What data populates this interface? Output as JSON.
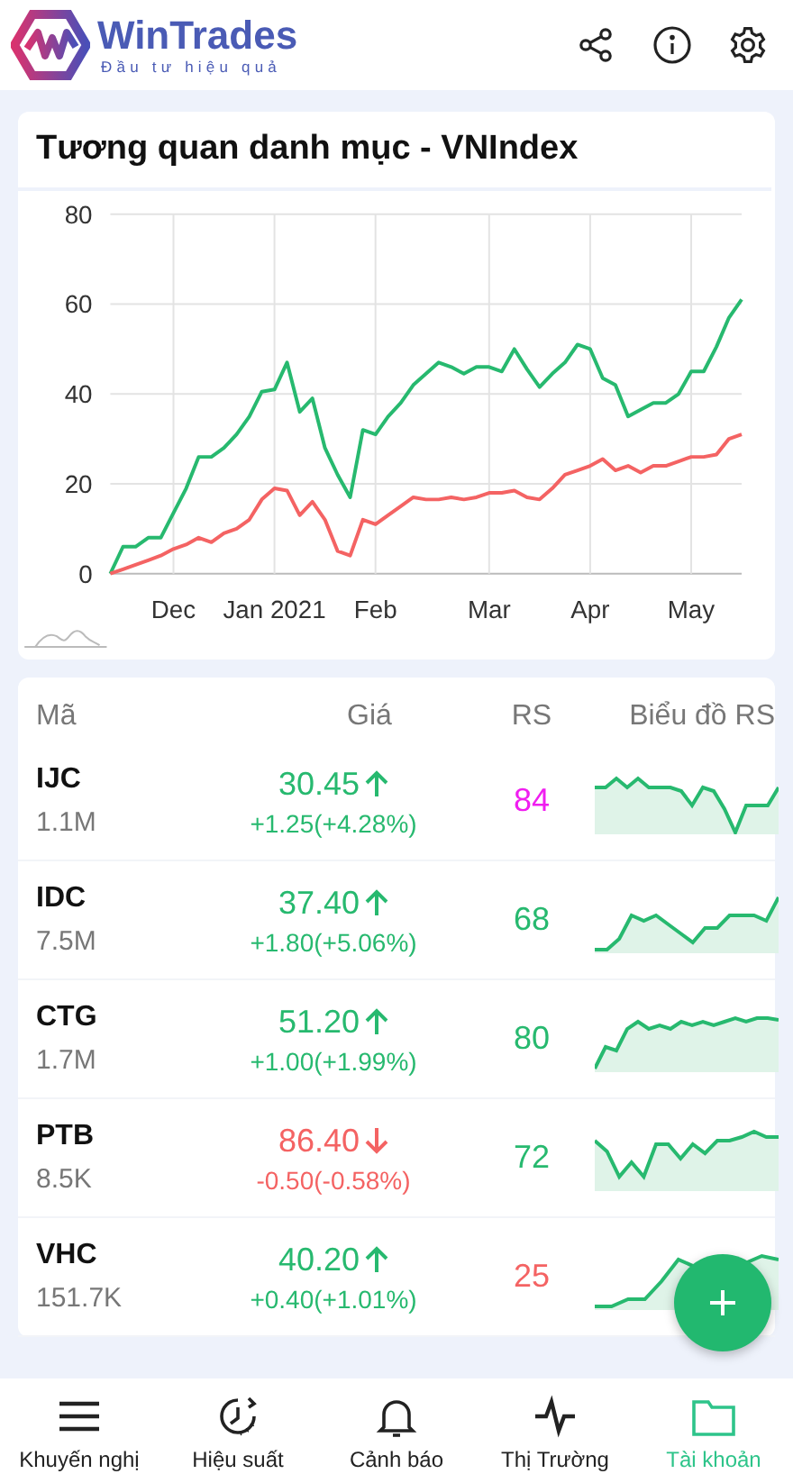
{
  "app": {
    "name": "WinTrades",
    "tagline": "Đầu tư hiệu quả"
  },
  "chart_card": {
    "title": "Tương quan danh mục - VNIndex",
    "chart_data": {
      "type": "line",
      "categories": [
        null,
        null,
        null,
        null,
        null,
        "Dec",
        null,
        null,
        null,
        null,
        null,
        null,
        null,
        "Jan 2021",
        null,
        null,
        null,
        null,
        null,
        null,
        null,
        "Feb",
        null,
        null,
        null,
        null,
        null,
        null,
        null,
        null,
        "Mar",
        null,
        null,
        null,
        null,
        null,
        null,
        null,
        "Apr",
        null,
        null,
        null,
        null,
        null,
        null,
        null,
        "May",
        null,
        null,
        null,
        null
      ],
      "series": [
        {
          "color": "#27b96f",
          "values": [
            0,
            6,
            6,
            8,
            8,
            13.5,
            19,
            26,
            26,
            28,
            31,
            35,
            40.5,
            41,
            47,
            36,
            39,
            28,
            22,
            17,
            32,
            31,
            35,
            38,
            42,
            44.5,
            47,
            46,
            44.5,
            46,
            46,
            45,
            50,
            45.5,
            41.5,
            44.5,
            47,
            51,
            50,
            43.5,
            42,
            35,
            36.5,
            38,
            38,
            40,
            45,
            45,
            50.5,
            57,
            61
          ]
        },
        {
          "color": "#f46363",
          "values": [
            0,
            1,
            2,
            3,
            4,
            5.5,
            6.5,
            8,
            7,
            9,
            10,
            12,
            16.5,
            19,
            18.5,
            13,
            16,
            12,
            5,
            4,
            12,
            11,
            13,
            15,
            17,
            16.5,
            16.5,
            17,
            16.5,
            17,
            18,
            18,
            18.5,
            17,
            16.5,
            19,
            22,
            23,
            24,
            25.5,
            23,
            24,
            22.5,
            24,
            24,
            25,
            26,
            26,
            26.5,
            30,
            31
          ]
        }
      ],
      "grid": true,
      "ylim": [
        0,
        80
      ],
      "yticks": [
        0,
        20,
        40,
        60,
        80
      ]
    }
  },
  "table": {
    "columns": [
      "Mã",
      "Giá",
      "RS",
      "Biểu đồ RS"
    ],
    "rows": [
      {
        "symbol": "IJC",
        "volume": "1.1M",
        "price": "30.45",
        "kind": "up",
        "change": "+1.25(+4.28%)",
        "rs": "84",
        "color": "#f01ef0"
      },
      {
        "symbol": "IDC",
        "volume": "7.5M",
        "price": "37.40",
        "kind": "up",
        "change": "+1.80(+5.06%)",
        "rs": "68",
        "color": "#27b96f"
      },
      {
        "symbol": "CTG",
        "volume": "1.7M",
        "price": "51.20",
        "kind": "up",
        "change": "+1.00(+1.99%)",
        "rs": "80",
        "color": "#27b96f"
      },
      {
        "symbol": "PTB",
        "volume": "8.5K",
        "price": "86.40",
        "kind": "down",
        "change": "-0.50(-0.58%)",
        "rs": "72",
        "color": "#27b96f"
      },
      {
        "symbol": "VHC",
        "volume": "151.7K",
        "price": "40.20",
        "kind": "up",
        "change": "+0.40(+1.01%)",
        "rs": "25",
        "color": "#f46363"
      }
    ]
  },
  "tab_bar": [
    {
      "label": "Khuyến nghị",
      "selected": false
    },
    {
      "label": "Hiệu suất",
      "selected": false
    },
    {
      "label": "Cảnh báo",
      "selected": false
    },
    {
      "label": "Thị Trường",
      "selected": false
    },
    {
      "label": "Tài khoản",
      "selected": true
    }
  ]
}
